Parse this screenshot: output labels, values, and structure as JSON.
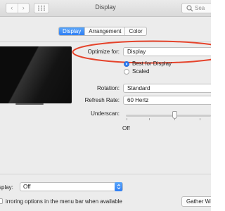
{
  "window": {
    "title": "Display",
    "search_placeholder": "Sea"
  },
  "icons": {
    "back": "‹",
    "forward": "›"
  },
  "tabs": [
    {
      "label": "Display",
      "active": true
    },
    {
      "label": "Arrangement",
      "active": false
    },
    {
      "label": "Color",
      "active": false
    }
  ],
  "settings": {
    "optimize_label": "Optimize for:",
    "optimize_value": "Display",
    "resolution_options": [
      {
        "label": "Best for Display",
        "selected": true
      },
      {
        "label": "Scaled",
        "selected": false
      }
    ],
    "rotation_label": "Rotation:",
    "rotation_value": "Standard",
    "refresh_label": "Refresh Rate:",
    "refresh_value": "60 Hertz",
    "underscan_label": "Underscan:",
    "underscan_min_label": "Off",
    "underscan_value_fraction": 0.55
  },
  "bottom": {
    "airplay_label": "splay:",
    "airplay_value": "Off",
    "mirroring_label": "irroring options in the menu bar when available",
    "mirroring_checked": false,
    "gather_button": "Gather Windo"
  },
  "colors": {
    "accent": "#2f7ef4",
    "highlight_ellipse": "#e5432b"
  }
}
